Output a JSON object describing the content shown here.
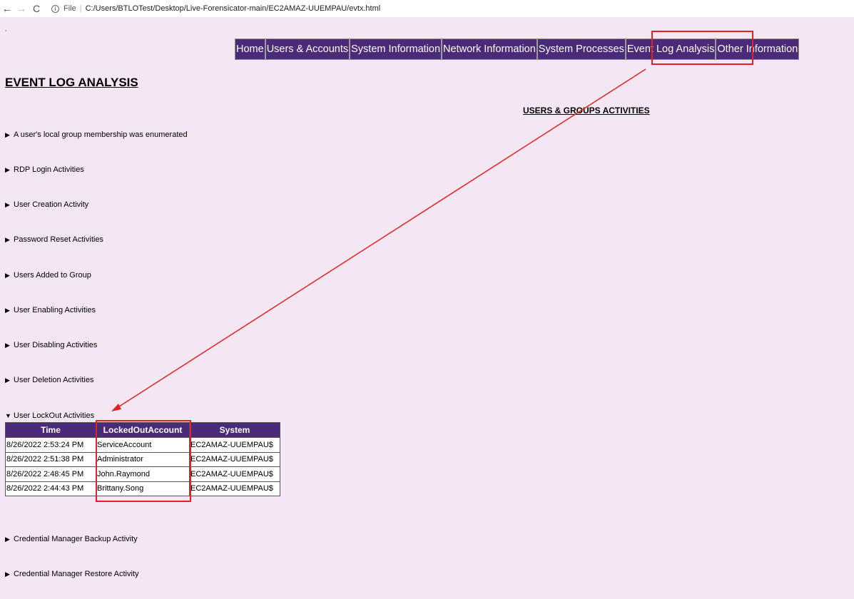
{
  "browser": {
    "back": "←",
    "forward": "→",
    "reload": "C",
    "info_icon": "i",
    "file_label": "File",
    "url": "C:/Users/BTLOTest/Desktop/Live-Forensicator-main/EC2AMAZ-UUEMPAU/evtx.html"
  },
  "stray_mark": ",",
  "menu": {
    "items": [
      "Home",
      "Users & Accounts",
      "System Information",
      "Network Information",
      "System Processes",
      "Event Log Analysis",
      "Other Information"
    ]
  },
  "page_title": "EVENT LOG ANALYSIS",
  "section_title": "USERS & GROUPS ACTIVITIES",
  "collapsed_caret": "▶",
  "expanded_caret": "▼",
  "sections": [
    "A user's local group membership was enumerated",
    "RDP Login Activities",
    "User Creation Activity",
    "Password Reset Activities",
    "Users Added to Group",
    "User Enabling Activities",
    "User Disabling Activities",
    "User Deletion Activities",
    "User LockOut Activities",
    "Credential Manager Backup Activity",
    "Credential Manager Restore Activity"
  ],
  "lockout_table": {
    "headers": [
      "Time",
      "LockedOutAccount",
      "System"
    ],
    "rows": [
      [
        "8/26/2022 2:53:24 PM",
        "ServiceAccount",
        "EC2AMAZ-UUEMPAU$"
      ],
      [
        "8/26/2022 2:51:38 PM",
        "Administrator",
        "EC2AMAZ-UUEMPAU$"
      ],
      [
        "8/26/2022 2:48:45 PM",
        "John.Raymond",
        "EC2AMAZ-UUEMPAU$"
      ],
      [
        "8/26/2022 2:44:43 PM",
        "Brittany.Song",
        "EC2AMAZ-UUEMPAU$"
      ]
    ]
  },
  "colors": {
    "page_bg": "#f5e6f3",
    "nav_bg": "#4b2a79",
    "annotation_red": "#e3231f"
  }
}
